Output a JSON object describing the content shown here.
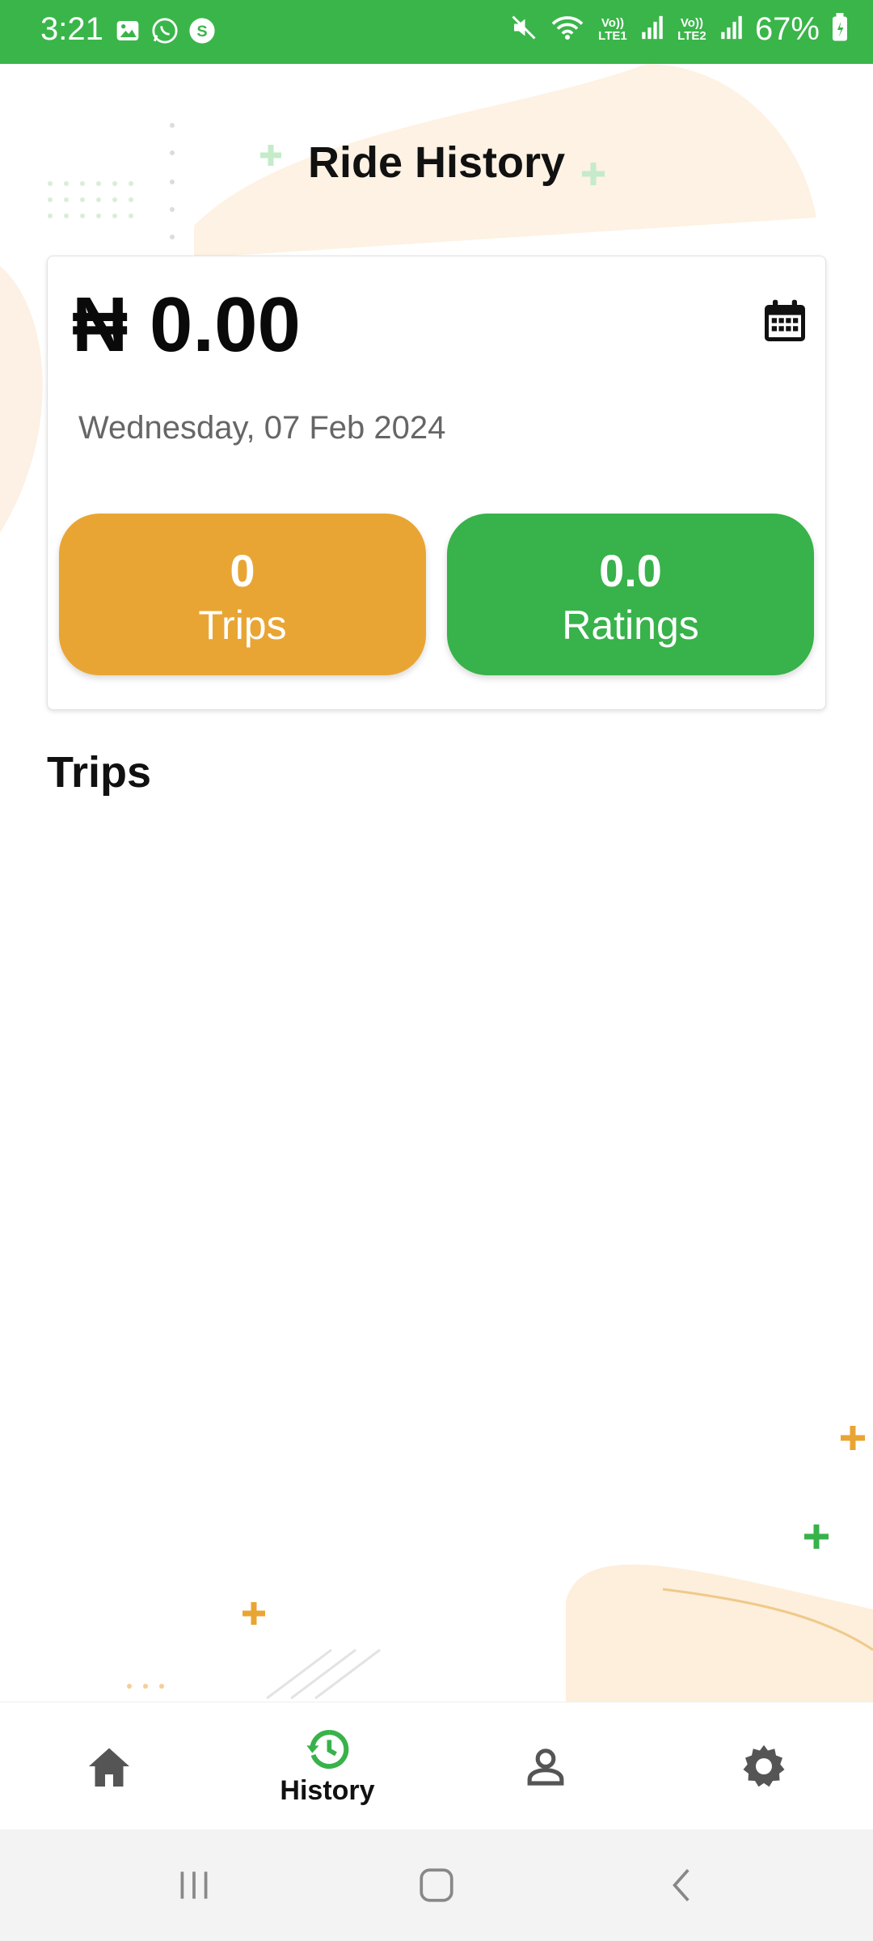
{
  "status_bar": {
    "time": "3:21",
    "battery": "67%",
    "sim1": "Vo)) LTE1",
    "sim2": "Vo)) LTE2",
    "icons": [
      "gallery-icon",
      "whatsapp-icon",
      "s-app-icon",
      "mute-icon",
      "wifi-icon",
      "signal-icon",
      "battery-icon"
    ]
  },
  "header": {
    "title": "Ride History"
  },
  "summary": {
    "amount": "₦ 0.00",
    "date": "Wednesday, 07 Feb 2024",
    "trips": {
      "value": "0",
      "label": "Trips"
    },
    "ratings": {
      "value": "0.0",
      "label": "Ratings"
    }
  },
  "section": {
    "title": "Trips"
  },
  "bottom_nav": {
    "items": [
      {
        "icon": "home-icon",
        "label": ""
      },
      {
        "icon": "history-icon",
        "label": "History",
        "active": true
      },
      {
        "icon": "person-icon",
        "label": ""
      },
      {
        "icon": "gear-icon",
        "label": ""
      }
    ]
  },
  "colors": {
    "status_bar": "#3ab54a",
    "trips_pill": "#e9a533",
    "ratings_pill": "#38b24a",
    "active_nav": "#38b24a"
  }
}
